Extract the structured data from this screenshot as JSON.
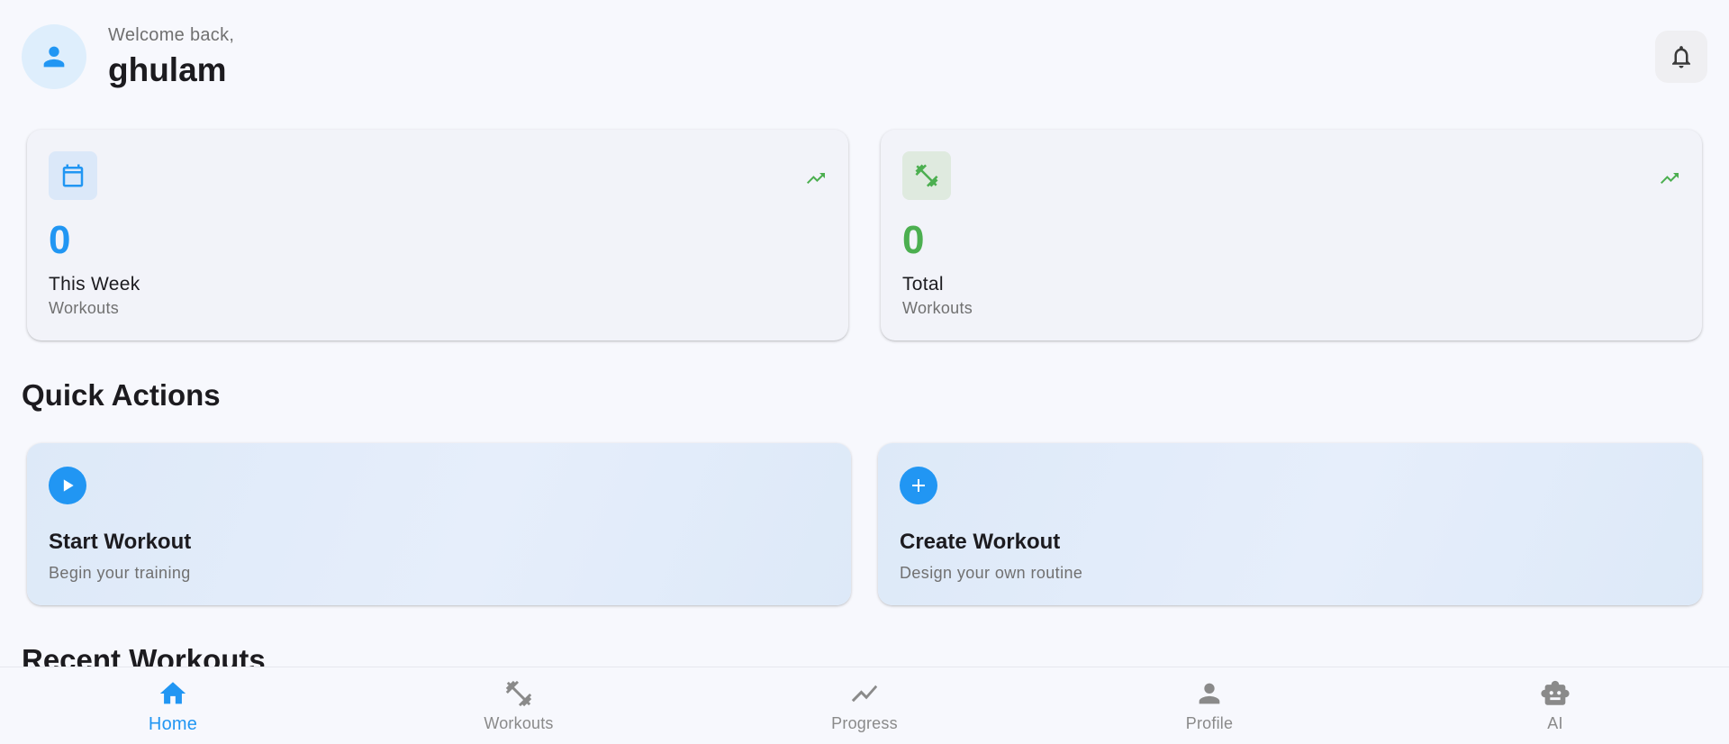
{
  "header": {
    "welcome": "Welcome back,",
    "user_name": "ghulam"
  },
  "stats": [
    {
      "value": "0",
      "label": "This Week",
      "sub": "Workouts",
      "color": "#2196f3",
      "icon": "calendar-icon"
    },
    {
      "value": "0",
      "label": "Total",
      "sub": "Workouts",
      "color": "#4caf50",
      "icon": "dumbbell-icon"
    }
  ],
  "quick_actions": {
    "title": "Quick Actions",
    "items": [
      {
        "title": "Start Workout",
        "sub": "Begin your training",
        "icon": "play-icon"
      },
      {
        "title": "Create Workout",
        "sub": "Design your own routine",
        "icon": "plus-icon"
      }
    ]
  },
  "recent": {
    "title": "Recent Workouts"
  },
  "nav": {
    "items": [
      {
        "label": "Home",
        "icon": "home-icon",
        "active": true
      },
      {
        "label": "Workouts",
        "icon": "dumbbell-icon"
      },
      {
        "label": "Progress",
        "icon": "trend-icon"
      },
      {
        "label": "Profile",
        "icon": "person-icon"
      },
      {
        "label": "AI",
        "icon": "robot-icon"
      }
    ]
  },
  "colors": {
    "primary": "#2196f3",
    "success": "#4caf50",
    "muted": "#8a8a8a"
  }
}
